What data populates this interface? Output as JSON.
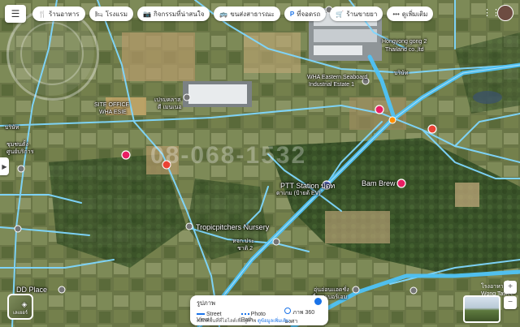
{
  "header": {
    "menu_icon": "hamburger-icon",
    "chips": [
      {
        "icon": "fork-knife-icon",
        "label": "ร้านอาหาร"
      },
      {
        "icon": "bed-icon",
        "label": "โรงแรม"
      },
      {
        "icon": "camera-icon",
        "label": "กิจกรรมที่น่าสนใจ"
      },
      {
        "icon": "bus-icon",
        "label": "ขนส่งสาธารณะ"
      },
      {
        "icon": "parking-icon",
        "label": "ที่จอดรถ"
      },
      {
        "icon": "cart-icon",
        "label": "ร้านขายยา"
      },
      {
        "icon": "more-icon",
        "label": "ดูเพิ่มเติม"
      }
    ]
  },
  "watermark": "08-068-1532",
  "map_labels": [
    {
      "text": "Hongyong gong 2",
      "small": true
    },
    {
      "text": "Thailand co.,ltd",
      "small": true
    },
    {
      "text": "บริษัท",
      "small": true
    },
    {
      "text": "WHA Eastern Seaboard",
      "small": true
    },
    {
      "text": "Industrial Estate 1",
      "small": true
    },
    {
      "text": "SITE OFFICE",
      "small": true
    },
    {
      "text": "WHA ESIE",
      "small": true
    },
    {
      "text": "เปรมคลาส",
      "small": true
    },
    {
      "text": "ดี เมนเนอ",
      "small": true
    },
    {
      "text": "PTT Station ปตท",
      "small": false
    },
    {
      "text": "ดาเกม (ป้ายด้ EV)",
      "small": true
    },
    {
      "text": "Bam Brew",
      "small": false
    },
    {
      "text": "Tropicpitchers Nursery",
      "small": false
    },
    {
      "text": "หจก.ประ",
      "small": true
    },
    {
      "text": "ชาติ 2",
      "small": true
    },
    {
      "text": "DD Place",
      "small": false
    },
    {
      "text": "บริษัท",
      "small": true
    },
    {
      "text": "ชุมชนตั้ง",
      "small": true
    },
    {
      "text": "ศูนย์บริการ",
      "small": true
    },
    {
      "text": "อุ่นอ่อนแอดชั่ง",
      "small": true
    },
    {
      "text": "ที่ดายเบอร์เอม",
      "small": true
    }
  ],
  "corner_label": {
    "line1": "โรงอาหาร",
    "line2": "Wong Tawee Farm"
  },
  "layers_button": {
    "icon": "layers-icon",
    "label": "เลเยอร์"
  },
  "legend": {
    "title": "รูปภาพ",
    "items": [
      "Street View",
      "Photo Path",
      "ภาพ 360 องศา"
    ],
    "note": "คลิกที่พื้นที่ที่ไฮไลต์เพื่อดูภาพ",
    "note_link": "ดูข้อมูลเพิ่มเติม"
  },
  "colors": {
    "road_highlight": "#4fc3f7",
    "road_main": "#7fd7ff",
    "accent": "#1a73e8",
    "pin_pink": "#e91e63",
    "pin_red": "#ea4335",
    "pin_blue": "#5c6bc0",
    "pin_gray": "#757575"
  }
}
